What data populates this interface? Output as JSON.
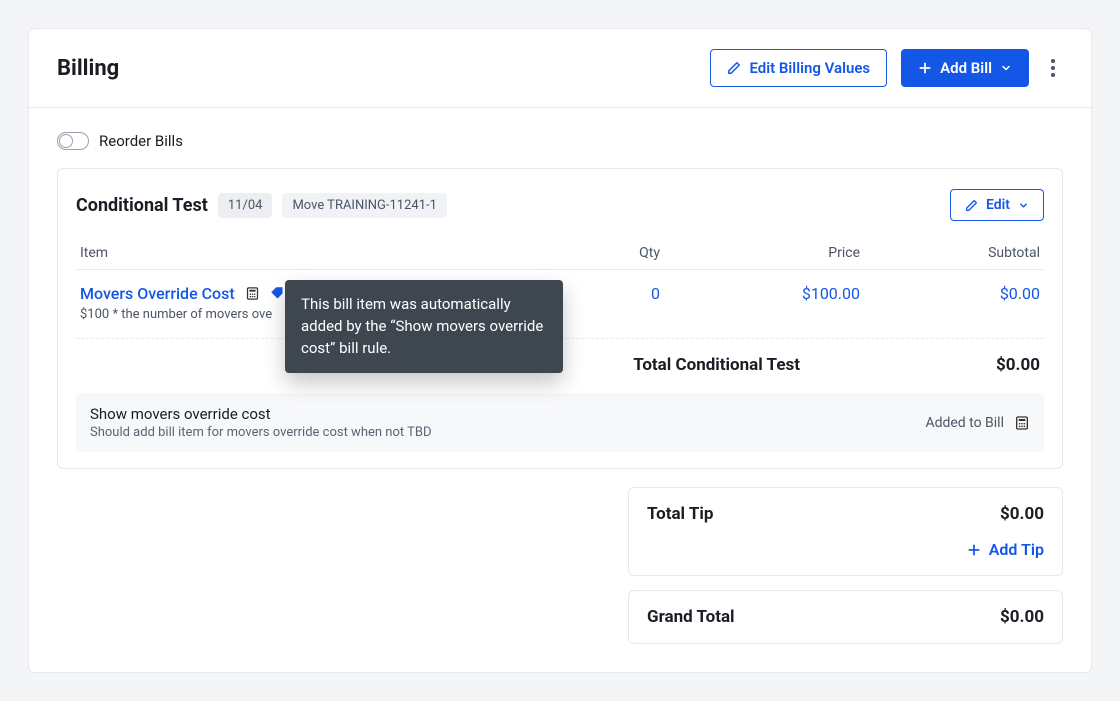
{
  "header": {
    "title": "Billing",
    "edit_values_label": "Edit Billing Values",
    "add_bill_label": "Add Bill"
  },
  "reorder": {
    "label": "Reorder Bills",
    "on": false
  },
  "bill": {
    "title": "Conditional Test",
    "date_chip": "11/04",
    "move_chip": "Move TRAINING-11241-1",
    "edit_label": "Edit",
    "columns": {
      "item": "Item",
      "qty": "Qty",
      "price": "Price",
      "subtotal": "Subtotal"
    },
    "items": [
      {
        "name": "Movers Override Cost",
        "description": "$100 * the number of movers ove",
        "qty": "0",
        "price": "$100.00",
        "subtotal": "$0.00",
        "tooltip": "This bill item was automatically added by the “Show movers override cost” bill rule."
      }
    ],
    "total": {
      "label": "Total Conditional Test",
      "amount": "$0.00"
    },
    "rule": {
      "name": "Show movers override cost",
      "description": "Should add bill item for movers override cost when not TBD",
      "status": "Added to Bill"
    }
  },
  "tip": {
    "label": "Total Tip",
    "amount": "$0.00",
    "add_label": "Add Tip"
  },
  "grand_total": {
    "label": "Grand Total",
    "amount": "$0.00"
  }
}
